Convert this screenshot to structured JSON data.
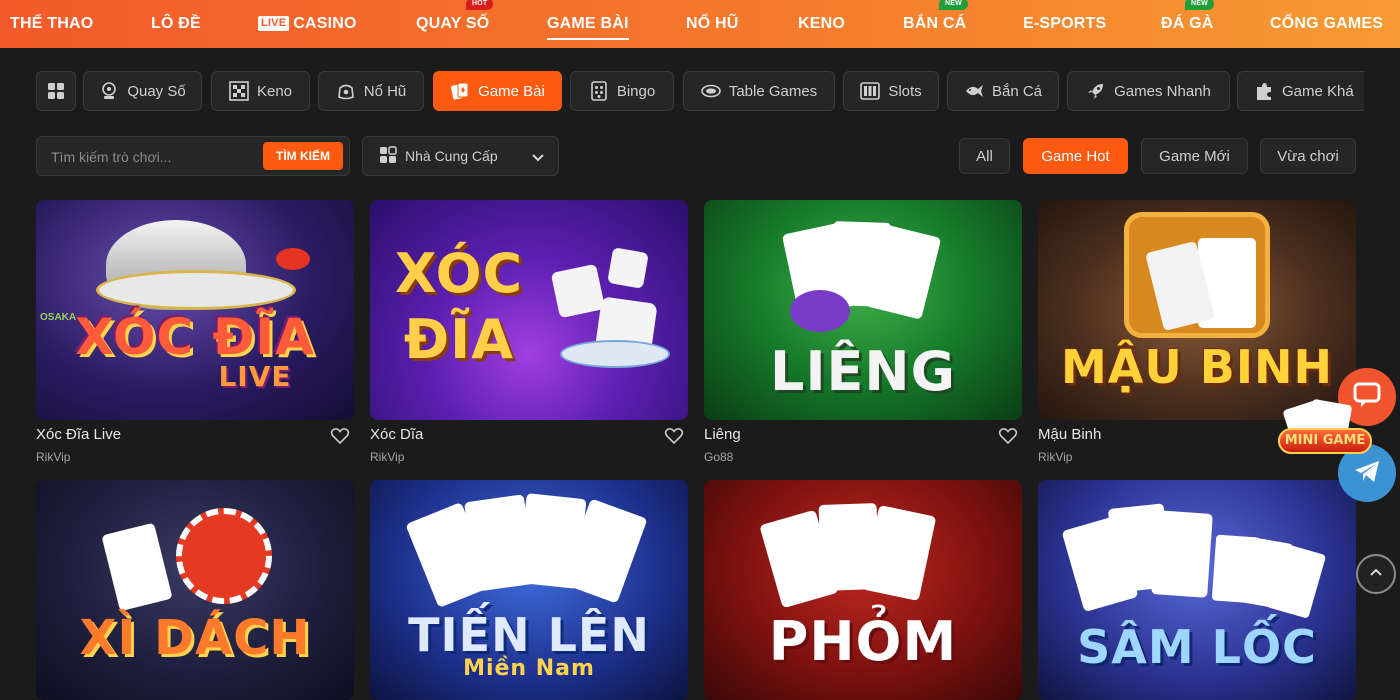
{
  "topnav": {
    "items": [
      {
        "label": "THỂ THAO"
      },
      {
        "label": "LÔ ĐỀ"
      },
      {
        "label": "CASINO",
        "badge": "LIVE"
      },
      {
        "label": "QUAY SỐ",
        "tag": "HOT"
      },
      {
        "label": "GAME BÀI",
        "active": true
      },
      {
        "label": "NỔ HŨ"
      },
      {
        "label": "KENO"
      },
      {
        "label": "BẮN CÁ",
        "tag": "NEW"
      },
      {
        "label": "E-SPORTS"
      },
      {
        "label": "ĐÁ GÀ",
        "tag": "NEW"
      },
      {
        "label": "CỔNG GAMES"
      }
    ],
    "colors": {
      "from": "#f35a2b",
      "to": "#f89a33"
    }
  },
  "categories": [
    {
      "label": "",
      "icon": "grid-icon"
    },
    {
      "label": "Quay Số",
      "icon": "lottery-icon"
    },
    {
      "label": "Keno",
      "icon": "keno-icon"
    },
    {
      "label": "Nổ Hũ",
      "icon": "jackpot-icon"
    },
    {
      "label": "Game Bài",
      "icon": "cards-icon",
      "active": true
    },
    {
      "label": "Bingo",
      "icon": "bingo-icon"
    },
    {
      "label": "Table Games",
      "icon": "table-icon"
    },
    {
      "label": "Slots",
      "icon": "slots-icon"
    },
    {
      "label": "Bắn Cá",
      "icon": "fish-icon"
    },
    {
      "label": "Games Nhanh",
      "icon": "rocket-icon"
    },
    {
      "label": "Game Khá",
      "icon": "puzzle-icon"
    }
  ],
  "search": {
    "placeholder": "Tìm kiếm trò chơi...",
    "button": "TÌM KIẾM"
  },
  "provider_filter": {
    "label": "Nhà Cung Cấp"
  },
  "filters": [
    {
      "label": "All"
    },
    {
      "label": "Game Hot",
      "active": true
    },
    {
      "label": "Game Mới"
    },
    {
      "label": "Vừa chơi"
    }
  ],
  "games": [
    {
      "title": "Xóc Đĩa Live",
      "provider": "RikVip",
      "art_text": "XÓC ĐĨA",
      "art_sub": "LIVE",
      "watermark": "OSAKA"
    },
    {
      "title": "Xóc Dĩa",
      "provider": "RikVip",
      "art_text": "XÓC",
      "art_text2": "ĐĨA"
    },
    {
      "title": "Liêng",
      "provider": "Go88",
      "art_text": "LIÊNG"
    },
    {
      "title": "Mậu Binh",
      "provider": "RikVip",
      "art_text": "MẬU BINH"
    },
    {
      "title": "",
      "provider": "",
      "art_text": "XÌ DÁCH"
    },
    {
      "title": "",
      "provider": "",
      "art_text": "TIẾN LÊN",
      "art_sub": "Miền Nam"
    },
    {
      "title": "",
      "provider": "",
      "art_text": "PHỎM"
    },
    {
      "title": "",
      "provider": "",
      "art_text": "SÂM LỐC"
    }
  ],
  "floating": {
    "mini_game": "MINI GAME"
  },
  "accent": "#fb5a10"
}
